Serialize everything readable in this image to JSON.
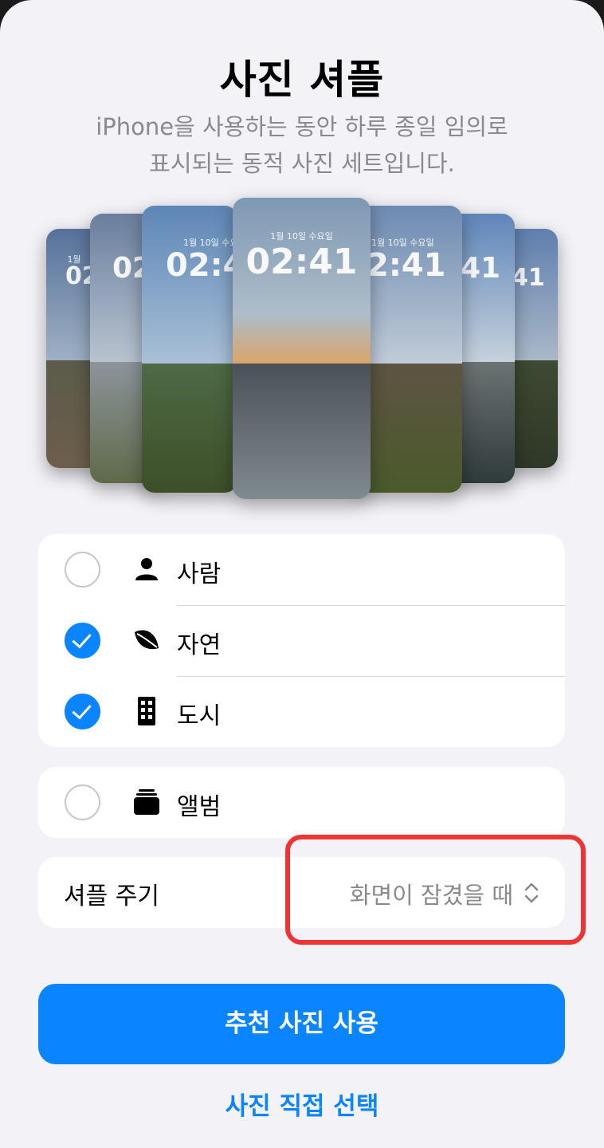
{
  "header": {
    "title": "사진 셔플",
    "subtitle_line1": "iPhone을 사용하는 동안 하루 종일 임의로",
    "subtitle_line2": "표시되는 동적 사진 세트입니다."
  },
  "gallery": {
    "cards": [
      {
        "date": "1월",
        "time": "02",
        "sky": "#6f86a6",
        "ground": "#4d4a3e"
      },
      {
        "date": "",
        "time": "02",
        "sky": "#8c9ab0",
        "ground": "#6b6f78"
      },
      {
        "date": "1월 10일 수요일",
        "time": "02:4",
        "sky": "#7fa1c6",
        "ground": "#5b6b3e"
      },
      {
        "date": "1월 10일 수요일",
        "time": "02:41",
        "sky": "#8fa3b8",
        "ground": "#6b7377"
      },
      {
        "date": "1월 10일 수요일",
        "time": "2:41",
        "sky": "#8da2bd",
        "ground": "#5b4c37"
      },
      {
        "date": "",
        "time": "41",
        "sky": "#7c99c0",
        "ground": "#4b5152"
      },
      {
        "date": "",
        "time": "41",
        "sky": "#6e8ab1",
        "ground": "#3f4a33"
      }
    ]
  },
  "categories": [
    {
      "label": "사람",
      "icon": "person-icon",
      "selected": false
    },
    {
      "label": "자연",
      "icon": "leaf-icon",
      "selected": true
    },
    {
      "label": "도시",
      "icon": "building-icon",
      "selected": true
    }
  ],
  "album": {
    "label": "앨범",
    "icon": "album-stack-icon",
    "selected": false
  },
  "shuffle": {
    "label": "셔플 주기",
    "value": "화면이 잠겼을 때"
  },
  "actions": {
    "primary_label": "추천 사진 사용",
    "secondary_label": "사진 직접 선택"
  },
  "colors": {
    "accent": "#0a84ff",
    "highlight": "#ee3434",
    "background": "#f2f2f7"
  }
}
